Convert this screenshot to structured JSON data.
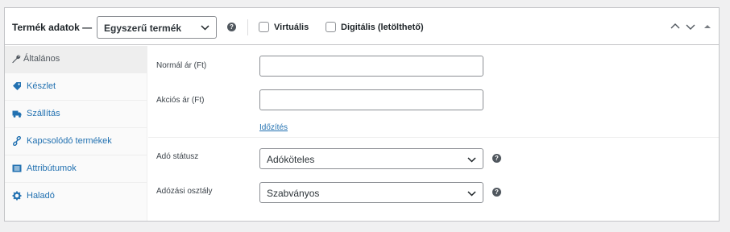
{
  "header": {
    "title": "Termék adatok —",
    "product_type_selected": "Egyszerű termék",
    "virtual_label": "Virtuális",
    "downloadable_label": "Digitális (letölthető)"
  },
  "sidebar": {
    "items": [
      {
        "label": "Általános",
        "icon": "wrench-icon",
        "active": true
      },
      {
        "label": "Készlet",
        "icon": "tag-icon"
      },
      {
        "label": "Szállítás",
        "icon": "truck-icon"
      },
      {
        "label": "Kapcsolódó termékek",
        "icon": "link-icon"
      },
      {
        "label": "Attribútumok",
        "icon": "list-icon"
      },
      {
        "label": "Haladó",
        "icon": "gear-icon"
      }
    ]
  },
  "general": {
    "regular_price_label": "Normál ár (Ft)",
    "regular_price_value": "",
    "sale_price_label": "Akciós ár (Ft)",
    "sale_price_value": "",
    "schedule_link": "Időzítés",
    "tax_status_label": "Adó státusz",
    "tax_status_value": "Adóköteles",
    "tax_class_label": "Adózási osztály",
    "tax_class_value": "Szabványos"
  },
  "colors": {
    "link": "#2271b1",
    "border": "#c3c4c7",
    "sidebar_bg": "#fafafa",
    "active_tab_bg": "#eeeeee"
  }
}
